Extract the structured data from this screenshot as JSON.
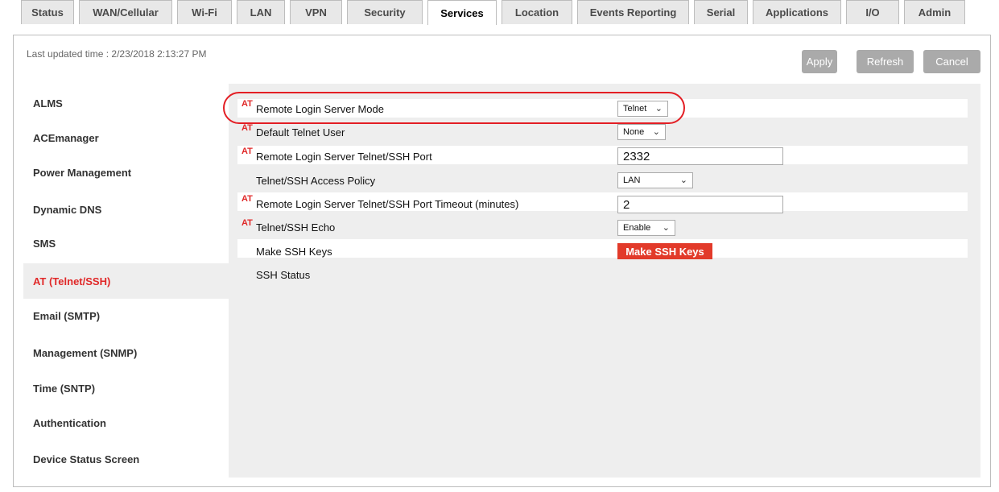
{
  "tabs": [
    {
      "label": "Status"
    },
    {
      "label": "WAN/Cellular"
    },
    {
      "label": "Wi-Fi"
    },
    {
      "label": "LAN"
    },
    {
      "label": "VPN"
    },
    {
      "label": "Security"
    },
    {
      "label": "Services",
      "active": true
    },
    {
      "label": "Location"
    },
    {
      "label": "Events Reporting"
    },
    {
      "label": "Serial"
    },
    {
      "label": "Applications"
    },
    {
      "label": "I/O"
    },
    {
      "label": "Admin"
    }
  ],
  "header": {
    "last_updated": "Last updated time : 2/23/2018 2:13:27 PM",
    "apply_label": "Apply",
    "refresh_label": "Refresh",
    "cancel_label": "Cancel"
  },
  "sidebar": {
    "items": [
      {
        "label": "ALMS"
      },
      {
        "label": "ACEmanager"
      },
      {
        "label": "Power Management"
      },
      {
        "label": "Dynamic DNS"
      },
      {
        "label": "SMS"
      },
      {
        "label": "AT (Telnet/SSH)",
        "active": true
      },
      {
        "label": "Email (SMTP)"
      },
      {
        "label": "Management (SNMP)"
      },
      {
        "label": "Time (SNTP)"
      },
      {
        "label": "Authentication"
      },
      {
        "label": "Device Status Screen"
      }
    ]
  },
  "settings": {
    "at_marker": "AT",
    "rows": [
      {
        "label": "Remote Login Server Mode",
        "at": true,
        "control": "select",
        "value": "Telnet"
      },
      {
        "label": "Default Telnet User",
        "at": true,
        "control": "select",
        "value": "None"
      },
      {
        "label": "Remote Login Server Telnet/SSH Port",
        "at": true,
        "control": "text",
        "value": "2332"
      },
      {
        "label": "Telnet/SSH Access Policy",
        "at": false,
        "control": "select",
        "value": "LAN"
      },
      {
        "label": "Remote Login Server Telnet/SSH Port Timeout (minutes)",
        "at": true,
        "control": "text",
        "value": "2"
      },
      {
        "label": "Telnet/SSH Echo",
        "at": true,
        "control": "select",
        "value": "Enable"
      },
      {
        "label": "Make SSH Keys",
        "at": false,
        "control": "button",
        "value": "Make SSH Keys"
      },
      {
        "label": "SSH Status",
        "at": false,
        "control": "none",
        "value": ""
      }
    ]
  },
  "colors": {
    "accent_red": "#e02828",
    "highlight_ring": "#e31e24",
    "button_grey": "#aaaaaa",
    "panel_bg": "#eeeeee"
  },
  "icons": {
    "dropdown": "chevron-down-icon"
  }
}
